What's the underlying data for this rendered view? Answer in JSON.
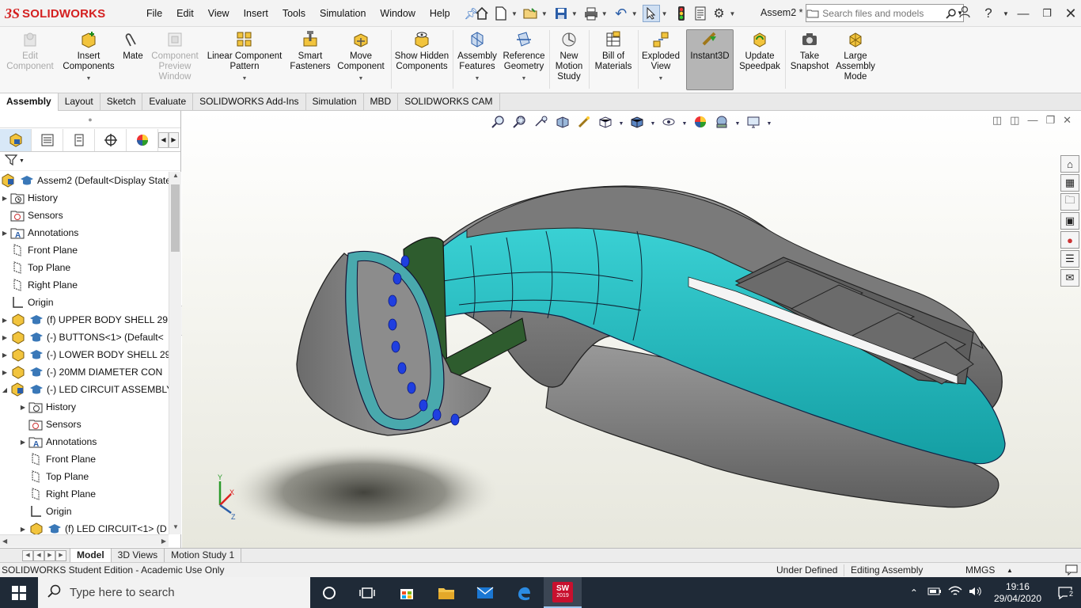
{
  "app": {
    "brand_prefix": "3S",
    "brand": "SOLIDWORKS",
    "doc_title": "Assem2 *"
  },
  "menu": [
    "File",
    "Edit",
    "View",
    "Insert",
    "Tools",
    "Simulation",
    "Window",
    "Help"
  ],
  "search": {
    "placeholder": "Search files and models"
  },
  "ribbon": {
    "edit_component": "Edit Component",
    "insert_components": "Insert Components",
    "mate": "Mate",
    "component_preview": "Component Preview Window",
    "linear_pattern": "Linear Component Pattern",
    "smart_fasteners": "Smart Fasteners",
    "move_component": "Move Component",
    "show_hidden": "Show Hidden Components",
    "assembly_features": "Assembly Features",
    "reference_geometry": "Reference Geometry",
    "new_motion_study": "New Motion Study",
    "bill_of_materials": "Bill of Materials",
    "exploded_view": "Exploded View",
    "instant3d": "Instant3D",
    "update_speedpak": "Update Speedpak",
    "take_snapshot": "Take Snapshot",
    "large_assembly": "Large Assembly Mode"
  },
  "command_tabs": [
    "Assembly",
    "Layout",
    "Sketch",
    "Evaluate",
    "SOLIDWORKS Add-Ins",
    "Simulation",
    "MBD",
    "SOLIDWORKS CAM"
  ],
  "tree": [
    {
      "label": "Assem2  (Default<Display State",
      "kind": "root"
    },
    {
      "label": "History"
    },
    {
      "label": "Sensors"
    },
    {
      "label": "Annotations"
    },
    {
      "label": "Front Plane"
    },
    {
      "label": "Top Plane"
    },
    {
      "label": "Right Plane"
    },
    {
      "label": "Origin"
    },
    {
      "label": "(f) UPPER BODY SHELL 29."
    },
    {
      "label": "(-) BUTTONS<1> (Default<"
    },
    {
      "label": "(-) LOWER BODY SHELL 29"
    },
    {
      "label": "(-) 20MM DIAMETER CON"
    },
    {
      "label": "(-) LED CIRCUIT ASSEMBLY"
    },
    {
      "label": "History"
    },
    {
      "label": "Sensors"
    },
    {
      "label": "Annotations"
    },
    {
      "label": "Front Plane"
    },
    {
      "label": "Top Plane"
    },
    {
      "label": "Right Plane"
    },
    {
      "label": "Origin"
    },
    {
      "label": "(f) LED CIRCUIT<1> (D"
    }
  ],
  "bottom_tabs": [
    "Model",
    "3D Views",
    "Motion Study 1"
  ],
  "status": {
    "edition": "SOLIDWORKS Student Edition - Academic Use Only",
    "defined": "Under Defined",
    "editing": "Editing Assembly",
    "units": "MMGS"
  },
  "taskbar": {
    "search_placeholder": "Type here to search",
    "time": "19:16",
    "date": "29/04/2020",
    "notifications": "2",
    "sw_badge": "2019"
  },
  "triad": {
    "x": "X",
    "y": "Y",
    "z": "Z"
  }
}
